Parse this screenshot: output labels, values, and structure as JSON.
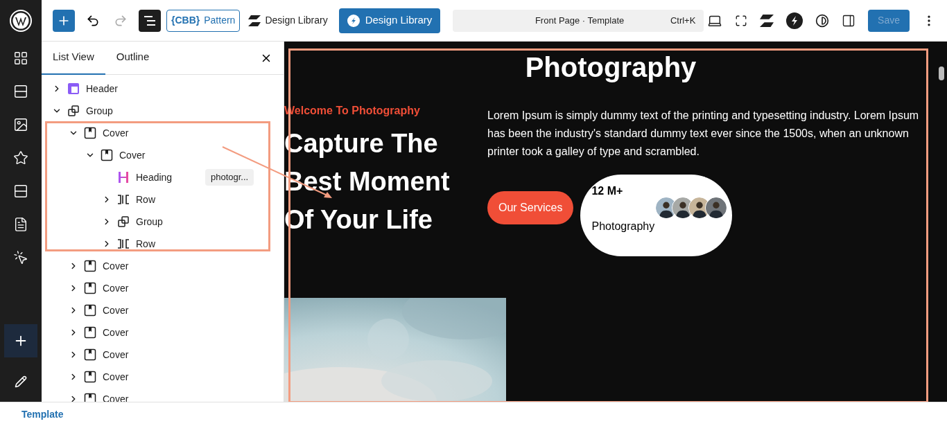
{
  "toolbar": {
    "redo": {
      "disabled": true
    },
    "pattern_button": {
      "brace_text": "{CBB}",
      "label": "Pattern"
    },
    "design_library_link": "Design Library",
    "design_library_button": "Design Library",
    "command_bar": {
      "title": "Front Page · Template",
      "shortcut": "Ctrl+K"
    },
    "save_button": {
      "label": "Save",
      "disabled": true
    }
  },
  "panel": {
    "tabs": [
      {
        "label": "List View",
        "selected": true
      },
      {
        "label": "Outline",
        "selected": false
      }
    ],
    "tree": [
      {
        "label": "Header",
        "kind": "header",
        "expanded": false
      },
      {
        "label": "Group",
        "kind": "group",
        "expanded": true,
        "children": [
          {
            "label": "Cover",
            "kind": "cover",
            "expanded": true,
            "children": [
              {
                "label": "Cover",
                "kind": "cover",
                "expanded": true,
                "children": [
                  {
                    "label": "Heading",
                    "kind": "heading",
                    "badge": "photogr..."
                  },
                  {
                    "label": "Row",
                    "kind": "row",
                    "expanded": false
                  },
                  {
                    "label": "Group",
                    "kind": "group",
                    "expanded": false
                  },
                  {
                    "label": "Row",
                    "kind": "row",
                    "expanded": false
                  }
                ]
              }
            ]
          },
          {
            "label": "Cover",
            "kind": "cover",
            "expanded": false
          },
          {
            "label": "Cover",
            "kind": "cover",
            "expanded": false
          },
          {
            "label": "Cover",
            "kind": "cover",
            "expanded": false
          },
          {
            "label": "Cover",
            "kind": "cover",
            "expanded": false
          },
          {
            "label": "Cover",
            "kind": "cover",
            "expanded": false
          },
          {
            "label": "Cover",
            "kind": "cover",
            "expanded": false
          },
          {
            "label": "Cover",
            "kind": "cover",
            "expanded": false
          }
        ]
      }
    ]
  },
  "canvas": {
    "title": "Photography",
    "eyebrow": "Welcome To Photography",
    "headline": [
      "Capture The",
      "Best Moment",
      "Of Your Life"
    ],
    "paragraph": "Lorem Ipsum is simply dummy text of the printing and typesetting industry. Lorem Ipsum has been the industry's standard dummy text ever since the 1500s, when an unknown printer took a galley of type and scrambled.",
    "services_button": "Our Services",
    "stat": {
      "value": "12 M+",
      "label": "Photography"
    }
  },
  "status_bar": {
    "label": "Template"
  }
}
